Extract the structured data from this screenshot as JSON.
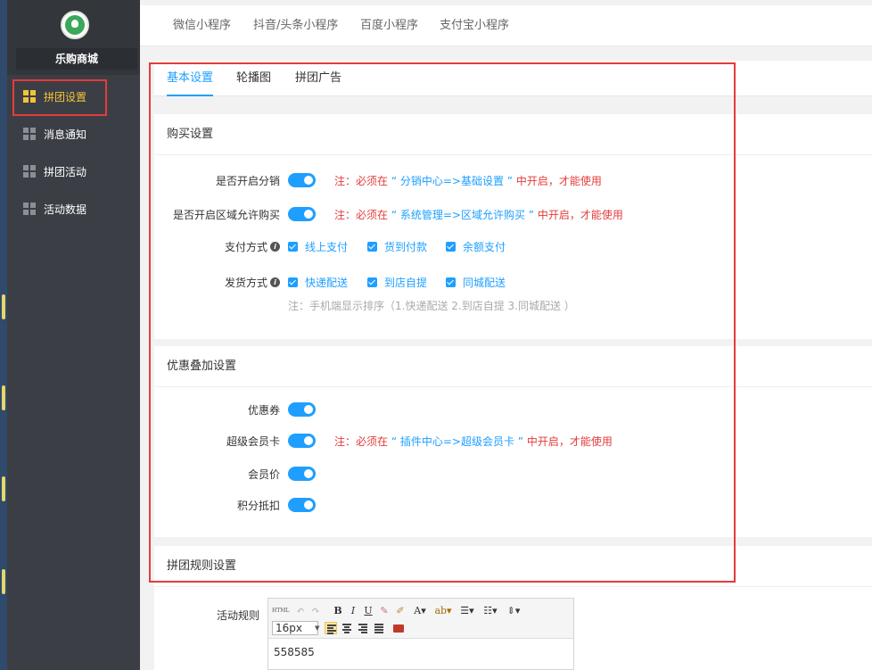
{
  "sidebar": {
    "brand": "乐购商城",
    "items": [
      {
        "label": "拼团设置",
        "active": true
      },
      {
        "label": "消息通知",
        "active": false
      },
      {
        "label": "拼团活动",
        "active": false
      },
      {
        "label": "活动数据",
        "active": false
      }
    ]
  },
  "top_tabs": [
    "微信小程序",
    "抖音/头条小程序",
    "百度小程序",
    "支付宝小程序"
  ],
  "sub_tabs": [
    {
      "label": "基本设置",
      "active": true
    },
    {
      "label": "轮播图",
      "active": false
    },
    {
      "label": "拼团广告",
      "active": false
    }
  ],
  "purchase": {
    "title": "购买设置",
    "distribution": {
      "label": "是否开启分销",
      "enabled": true,
      "note_prefix": "注：必须在",
      "note_path": "“ 分销中心=>基础设置 ”",
      "note_suffix": "中开启，才能使用"
    },
    "region": {
      "label": "是否开启区域允许购买",
      "enabled": true,
      "note_prefix": "注：必须在",
      "note_path": "“ 系统管理=>区域允许购买 ”",
      "note_suffix": "中开启，才能使用"
    },
    "payment": {
      "label": "支付方式",
      "options": [
        {
          "label": "线上支付",
          "checked": true
        },
        {
          "label": "货到付款",
          "checked": true
        },
        {
          "label": "余额支付",
          "checked": true
        }
      ]
    },
    "delivery": {
      "label": "发货方式",
      "options": [
        {
          "label": "快递配送",
          "checked": true
        },
        {
          "label": "到店自提",
          "checked": true
        },
        {
          "label": "同城配送",
          "checked": true
        }
      ],
      "hint": "注：手机端显示排序（1.快递配送 2.到店自提 3.同城配送 ）"
    }
  },
  "discount": {
    "title": "优惠叠加设置",
    "coupon": {
      "label": "优惠券",
      "enabled": true
    },
    "vip_card": {
      "label": "超级会员卡",
      "enabled": true,
      "note_prefix": "注：必须在",
      "note_path": "“ 插件中心=>超级会员卡 ”",
      "note_suffix": "中开启，才能使用"
    },
    "member_price": {
      "label": "会员价",
      "enabled": true
    },
    "points": {
      "label": "积分抵扣",
      "enabled": true
    }
  },
  "rules": {
    "title": "拼团规则设置",
    "label": "活动规则",
    "font_size": "16px",
    "content": "558585",
    "toolbar": {
      "html": "HTML",
      "bold": "B",
      "italic": "I",
      "underline": "U",
      "font_color": "A"
    }
  },
  "colors": {
    "accent": "#1e9fff",
    "warning": "#e53b3b",
    "sidebar_active": "#f3c338",
    "sidebar_bg": "#3b3f45"
  }
}
